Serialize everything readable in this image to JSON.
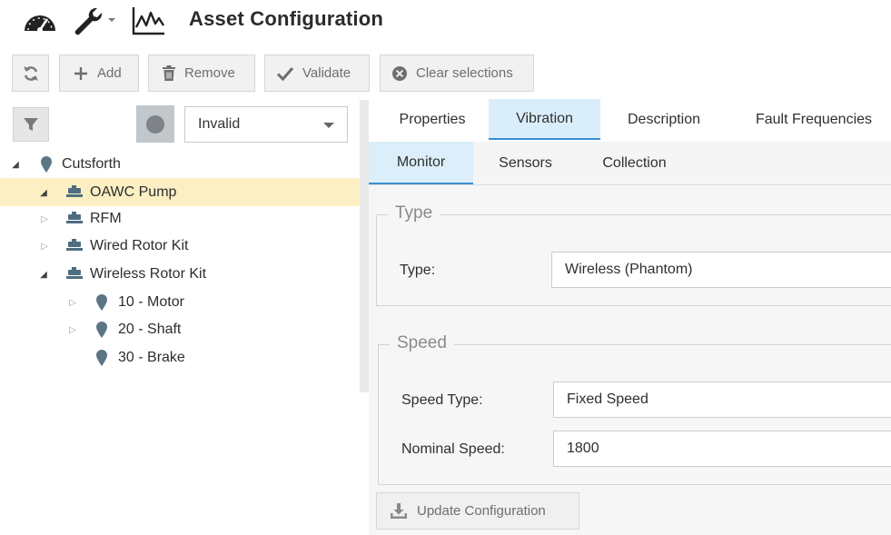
{
  "header": {
    "title": "Asset Configuration",
    "icons": [
      "dashboard-gauge-icon",
      "wrench-icon",
      "chevron-down-icon",
      "line-chart-icon"
    ]
  },
  "toolbar": {
    "refresh_icon": "refresh-icon",
    "add_label": "Add",
    "remove_label": "Remove",
    "validate_label": "Validate",
    "clear_label": "Clear selections"
  },
  "filter": {
    "selected_status": "Invalid"
  },
  "tree": {
    "nodes": [
      {
        "label": "Cutsforth",
        "icon": "location-pin-icon",
        "expanded": true,
        "selected": false
      },
      {
        "label": "OAWC Pump",
        "icon": "motor-icon",
        "expanded": true,
        "selected": true
      },
      {
        "label": "RFM",
        "icon": "motor-icon",
        "expanded": false,
        "selected": false
      },
      {
        "label": "Wired Rotor Kit",
        "icon": "motor-icon",
        "expanded": false,
        "selected": false
      },
      {
        "label": "Wireless Rotor Kit",
        "icon": "motor-icon",
        "expanded": true,
        "selected": false
      },
      {
        "label": "10 - Motor",
        "icon": "location-pin-icon",
        "expanded": false,
        "selected": false
      },
      {
        "label": "20 - Shaft",
        "icon": "location-pin-icon",
        "expanded": false,
        "selected": false
      },
      {
        "label": "30 - Brake",
        "icon": "location-pin-icon",
        "expanded": null,
        "selected": false
      }
    ]
  },
  "tabs": {
    "items": [
      "Properties",
      "Vibration",
      "Description",
      "Fault Frequencies"
    ],
    "active": "Vibration"
  },
  "subtabs": {
    "items": [
      "Monitor",
      "Sensors",
      "Collection"
    ],
    "active": "Monitor"
  },
  "type_section": {
    "legend": "Type",
    "type_label": "Type:",
    "type_value": "Wireless (Phantom)"
  },
  "speed_section": {
    "legend": "Speed",
    "speed_type_label": "Speed Type:",
    "speed_type_value": "Fixed Speed",
    "nominal_speed_label": "Nominal Speed:",
    "nominal_speed_value": "1800"
  },
  "update_button": {
    "label": "Update Configuration"
  },
  "colors": {
    "selected_row": "#fbefc3",
    "active_tab": "#d9eefa",
    "active_tab_border": "#3c8fd0",
    "pin_icon": "#5d7686",
    "motor_icon": "#4f6d80"
  }
}
